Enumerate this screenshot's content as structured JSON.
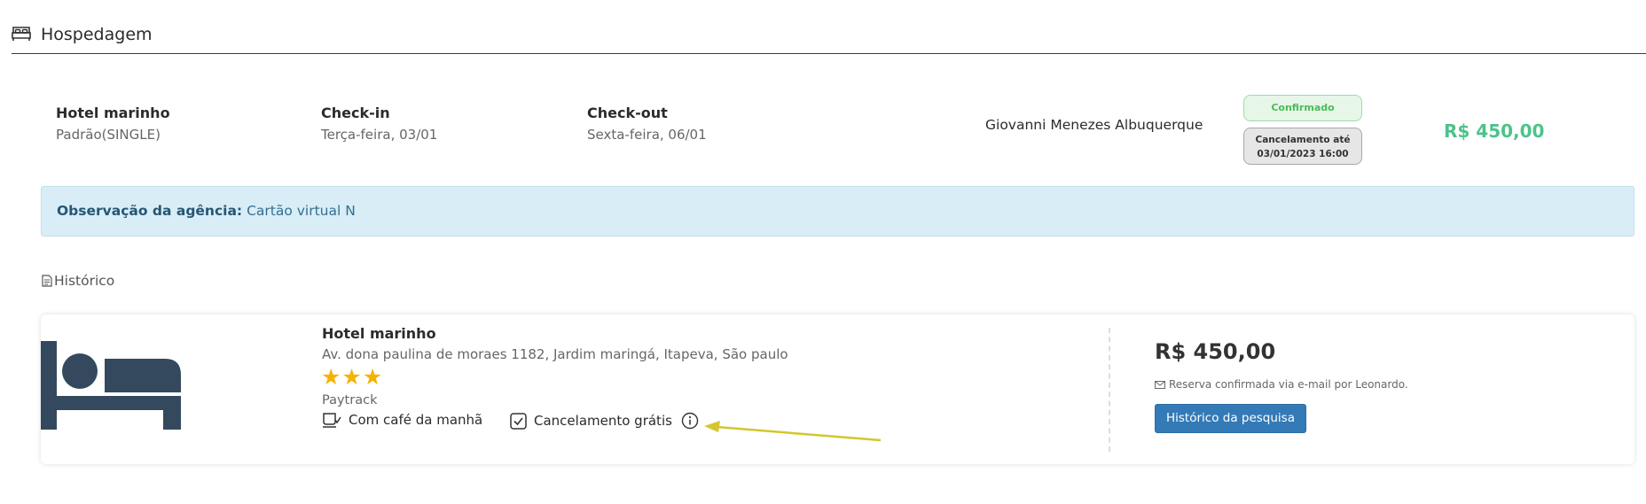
{
  "section": {
    "title": "Hospedagem",
    "icon": "bed-icon"
  },
  "summary": {
    "hotel_name": "Hotel marinho",
    "room_type": "Padrão(SINGLE)",
    "checkin_label": "Check-in",
    "checkin_value": "Terça-feira, 03/01",
    "checkout_label": "Check-out",
    "checkout_value": "Sexta-feira, 06/01",
    "guest": "Giovanni Menezes Albuquerque",
    "status": "Confirmado",
    "cancel_line1": "Cancelamento até",
    "cancel_line2": "03/01/2023 16:00",
    "price": "R$ 450,00"
  },
  "note": {
    "label": "Observação da agência:",
    "text": "Cartão virtual N"
  },
  "historico": {
    "label": "Histórico",
    "icon": "document-icon"
  },
  "card": {
    "hotel_name": "Hotel marinho",
    "address": "Av. dona paulina de moraes 1182, Jardim maringá, Itapeva, São paulo",
    "stars": "★★★",
    "star_rating": 3,
    "provider": "Paytrack",
    "breakfast": "Com café da manhã",
    "cancellation": "Cancelamento grátis",
    "price": "R$ 450,00",
    "confirmation": "Reserva confirmada via e-mail por Leonardo.",
    "history_button": "Histórico da pesquisa"
  },
  "colors": {
    "accent_green": "#4cc38a",
    "info_blue": "#337ab7",
    "note_bg": "#d9edf7",
    "star": "#f5b301",
    "hotel_image": "#34495e",
    "annotation_arrow": "#d4c62f"
  }
}
